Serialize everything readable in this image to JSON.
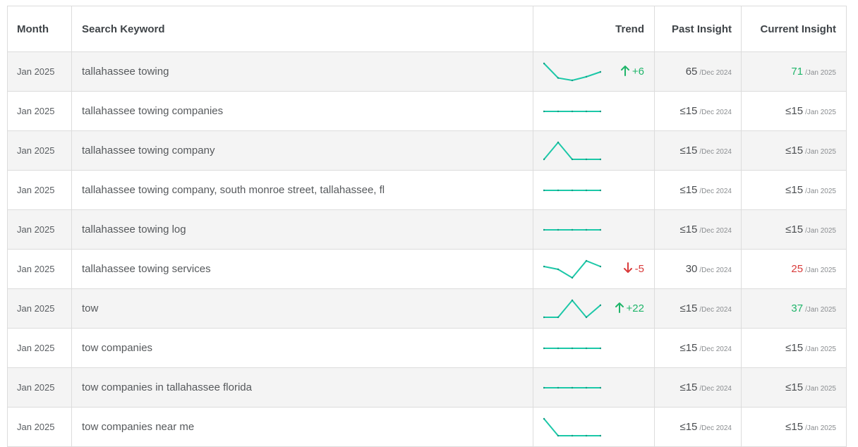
{
  "headers": {
    "month": "Month",
    "keyword": "Search Keyword",
    "trend": "Trend",
    "past": "Past Insight",
    "current": "Current Insight"
  },
  "colors": {
    "spark": "#1cc8a8",
    "up": "#1fb56a",
    "down": "#d93a3a"
  },
  "rows": [
    {
      "month": "Jan 2025",
      "keyword": "tallahassee towing",
      "trend": [
        72,
        60,
        58,
        61,
        65
      ],
      "delta": "+6",
      "direction": "up",
      "past": "65",
      "past_period": "/Dec 2024",
      "current": "71",
      "current_period": "/Jan 2025",
      "current_color": "green"
    },
    {
      "month": "Jan 2025",
      "keyword": "tallahassee towing companies",
      "trend": [
        15,
        15,
        15,
        15,
        15
      ],
      "delta": "",
      "direction": "",
      "past": "≤15",
      "past_period": "/Dec 2024",
      "current": "≤15",
      "current_period": "/Jan 2025",
      "current_color": ""
    },
    {
      "month": "Jan 2025",
      "keyword": "tallahassee towing company",
      "trend": [
        15,
        20,
        15,
        15,
        15
      ],
      "delta": "",
      "direction": "",
      "past": "≤15",
      "past_period": "/Dec 2024",
      "current": "≤15",
      "current_period": "/Jan 2025",
      "current_color": ""
    },
    {
      "month": "Jan 2025",
      "keyword": "tallahassee towing company, south monroe street, tallahassee, fl",
      "trend": [
        15,
        15,
        15,
        15,
        15
      ],
      "delta": "",
      "direction": "",
      "past": "≤15",
      "past_period": "/Dec 2024",
      "current": "≤15",
      "current_period": "/Jan 2025",
      "current_color": ""
    },
    {
      "month": "Jan 2025",
      "keyword": "tallahassee towing log",
      "trend": [
        15,
        15,
        15,
        15,
        15
      ],
      "delta": "",
      "direction": "",
      "past": "≤15",
      "past_period": "/Dec 2024",
      "current": "≤15",
      "current_period": "/Jan 2025",
      "current_color": ""
    },
    {
      "month": "Jan 2025",
      "keyword": "tallahassee towing services",
      "trend": [
        29,
        28,
        25,
        31,
        29
      ],
      "delta": "-5",
      "direction": "down",
      "past": "30",
      "past_period": "/Dec 2024",
      "current": "25",
      "current_period": "/Jan 2025",
      "current_color": "red"
    },
    {
      "month": "Jan 2025",
      "keyword": "tow",
      "trend": [
        16,
        16,
        37,
        16,
        31
      ],
      "delta": "+22",
      "direction": "up",
      "past": "≤15",
      "past_period": "/Dec 2024",
      "current": "37",
      "current_period": "/Jan 2025",
      "current_color": "green"
    },
    {
      "month": "Jan 2025",
      "keyword": "tow companies",
      "trend": [
        15,
        15,
        15,
        15,
        15
      ],
      "delta": "",
      "direction": "",
      "past": "≤15",
      "past_period": "/Dec 2024",
      "current": "≤15",
      "current_period": "/Jan 2025",
      "current_color": ""
    },
    {
      "month": "Jan 2025",
      "keyword": "tow companies in tallahassee florida",
      "trend": [
        15,
        15,
        15,
        15,
        15
      ],
      "delta": "",
      "direction": "",
      "past": "≤15",
      "past_period": "/Dec 2024",
      "current": "≤15",
      "current_period": "/Jan 2025",
      "current_color": ""
    },
    {
      "month": "Jan 2025",
      "keyword": "tow companies near me",
      "trend": [
        21,
        15,
        15,
        15,
        15
      ],
      "delta": "",
      "direction": "",
      "past": "≤15",
      "past_period": "/Dec 2024",
      "current": "≤15",
      "current_period": "/Jan 2025",
      "current_color": ""
    }
  ]
}
